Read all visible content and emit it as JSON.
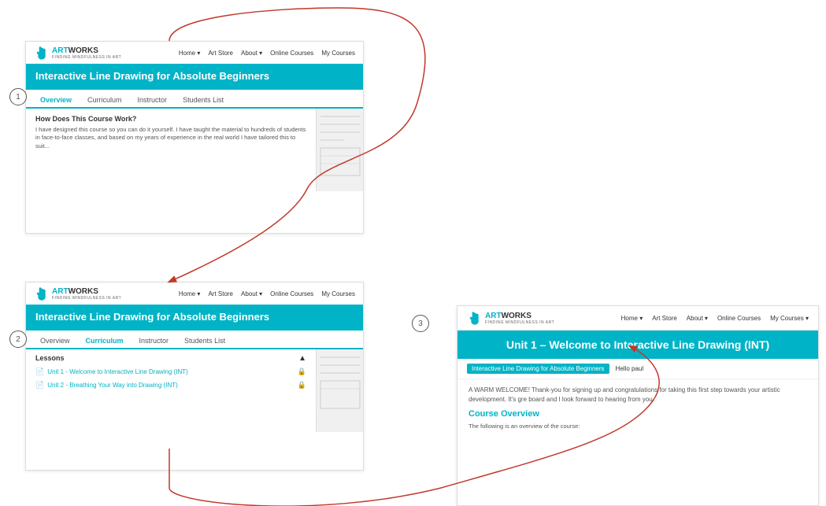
{
  "site": {
    "logo_art": "ART",
    "logo_works": "WORKS",
    "logo_subtitle": "FINDING MINDFULNESS IN ART"
  },
  "nav": {
    "home": "Home ▾",
    "art_store": "Art Store",
    "about": "About ▾",
    "online_courses": "Online Courses",
    "my_courses": "My Courses"
  },
  "panel1": {
    "course_title": "Interactive Line Drawing for Absolute Beginners",
    "tabs": [
      "Overview",
      "Curriculum",
      "Instructor",
      "Students List"
    ],
    "active_tab": "Overview",
    "section_title": "How Does This Course Work?",
    "description": "I have designed this course so you can do it yourself. I have taught the material to hundreds of students in face-to-face classes, and based on my years of experience in the real world I have tailored this to suit..."
  },
  "panel2": {
    "course_title": "Interactive Line Drawing for Absolute Beginners",
    "tabs": [
      "Overview",
      "Curriculum",
      "Instructor",
      "Students List"
    ],
    "active_tab": "Curriculum",
    "lessons_label": "Lessons",
    "lessons": [
      "Unit 1 - Welcome to Interactive Line Drawing (INT)",
      "Unit 2 - Breathing Your Way into Drawing (INT)"
    ]
  },
  "panel3": {
    "nav": {
      "home": "Home ▾",
      "art_store": "Art Store",
      "about": "About ▾",
      "online_courses": "Online Courses",
      "my_courses": "My Courses ▾"
    },
    "unit_title": "Unit 1 – Welcome to Interactive Line Drawing (INT)",
    "breadcrumb": "Interactive Line Drawing for Absolute Beginners",
    "user_greeting": "Hello paul",
    "welcome_text": "A WARM WELCOME! Thank-you for signing up and congratulations for taking this first step towards your artistic development. It's gre board and I look forward to hearing from you.",
    "course_overview_title": "Course Overview",
    "course_overview_text": "The following is an overview of the course:"
  },
  "labels": {
    "circle1": "1",
    "circle2": "2",
    "circle3": "3"
  }
}
